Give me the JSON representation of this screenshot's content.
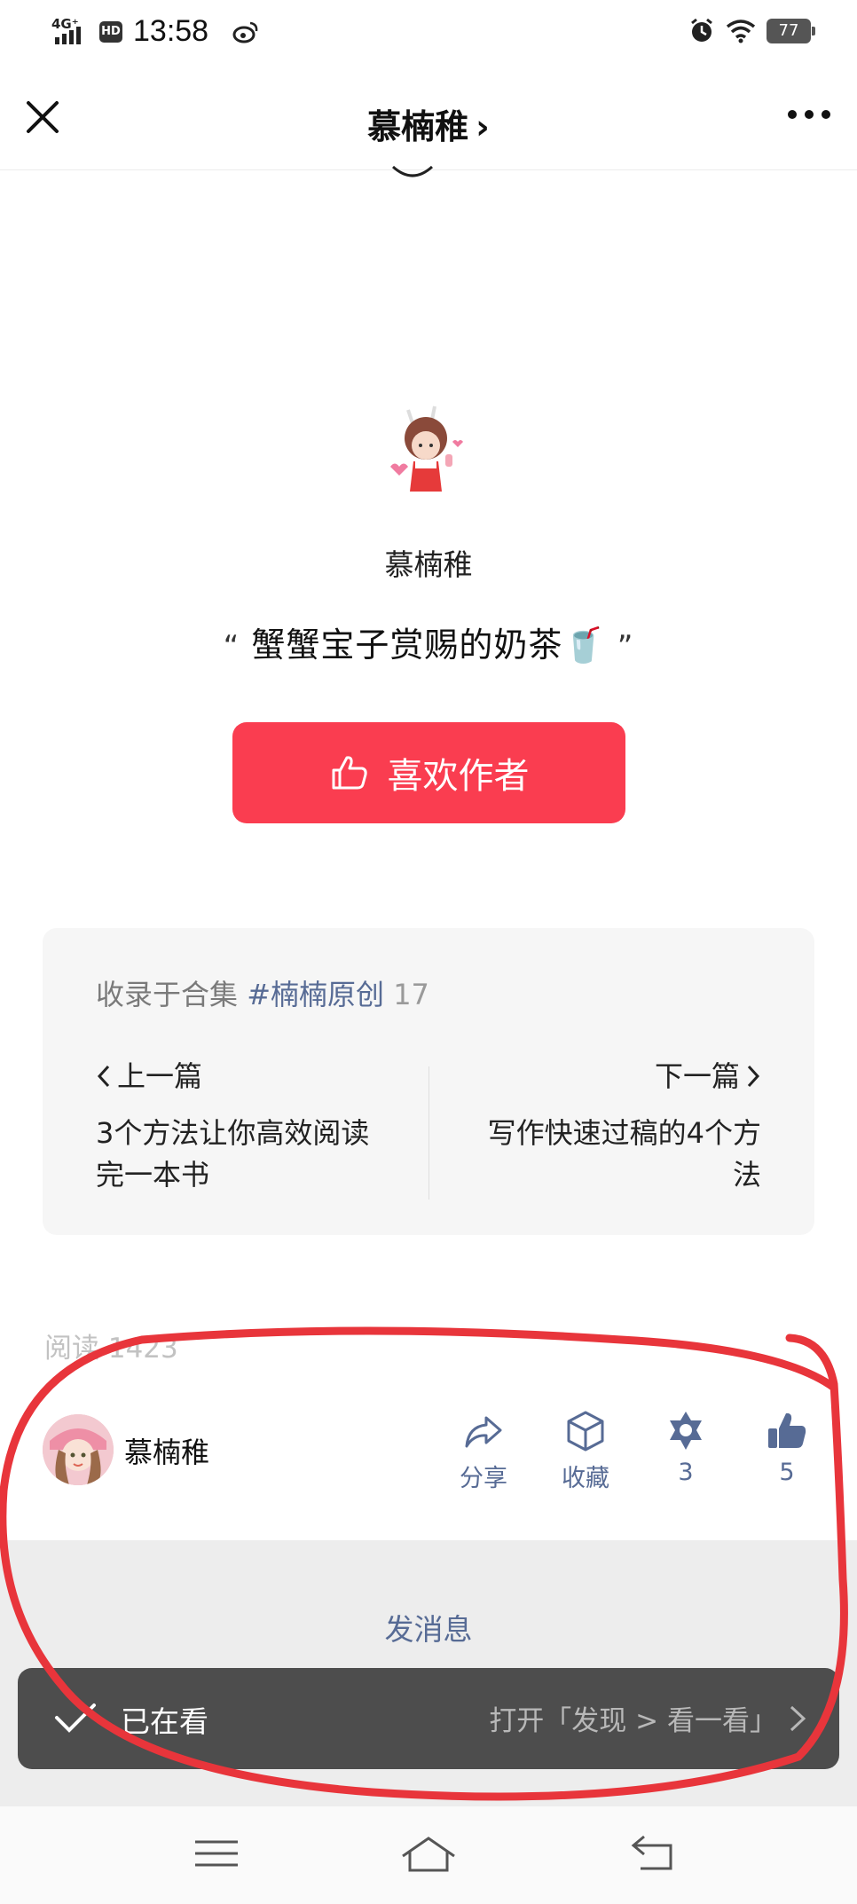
{
  "status_bar": {
    "network": "4G⁺",
    "hd": "HD",
    "time": "13:58",
    "battery": "77"
  },
  "nav": {
    "title": "慕楠稚",
    "chevron": "›"
  },
  "reward": {
    "name": "慕楠稚",
    "quote_open": "“",
    "quote_text": "蟹蟹宝子赏赐的奶茶🥤",
    "quote_close": "”",
    "like_button": "喜欢作者"
  },
  "collection": {
    "prefix": "收录于合集",
    "tag": "#楠楠原创",
    "count": "17",
    "prev_label": "上一篇",
    "prev_article": "3个方法让你高效阅读完一本书",
    "next_label": "下一篇",
    "next_article": "写作快速过稿的4个方法"
  },
  "read_count": "阅读 1423",
  "action_bar": {
    "author_name": "慕楠稚",
    "share": "分享",
    "favorite": "收藏",
    "wow_count": "3",
    "like_count": "5"
  },
  "message": {
    "send_message": "发消息"
  },
  "toast": {
    "text": "已在看",
    "link": "打开「发现 > 看一看」"
  },
  "colors": {
    "accent_red": "#fa3d50",
    "link_blue": "#576b95",
    "annotation_red": "#e8353b",
    "toast_bg": "#4d4d4d"
  }
}
